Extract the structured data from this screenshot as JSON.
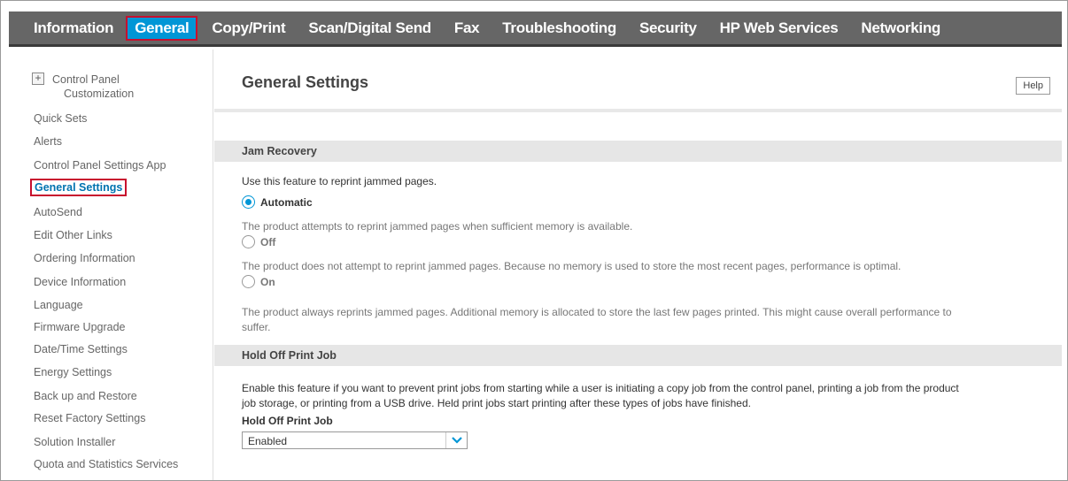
{
  "topnav": {
    "items": [
      "Information",
      "General",
      "Copy/Print",
      "Scan/Digital Send",
      "Fax",
      "Troubleshooting",
      "Security",
      "HP Web Services",
      "Networking"
    ],
    "active": "General"
  },
  "sidebar": {
    "expand_symbol": "+",
    "control_panel_line1": "Control Panel",
    "control_panel_line2": "Customization",
    "items": [
      "Quick Sets",
      "Alerts",
      "Control Panel Settings App",
      "General Settings",
      "AutoSend",
      "Edit Other Links",
      "Ordering Information",
      "Device Information",
      "Language",
      "Firmware Upgrade",
      "Date/Time Settings",
      "Energy Settings",
      "Back up and Restore",
      "Reset Factory Settings",
      "Solution Installer",
      "Quota and Statistics Services"
    ],
    "active": "General Settings"
  },
  "main": {
    "title": "General Settings",
    "help_label": "Help",
    "jam": {
      "title": "Jam Recovery",
      "intro": "Use this feature to reprint jammed pages.",
      "options": [
        {
          "label": "Automatic",
          "selected": true,
          "desc": "The product attempts to reprint jammed pages when sufficient memory is available."
        },
        {
          "label": "Off",
          "selected": false,
          "desc": "The product does not attempt to reprint jammed pages. Because no memory is used to store the most recent pages, performance is optimal."
        },
        {
          "label": "On",
          "selected": false,
          "desc_line1": "The product always reprints jammed pages. Additional memory is allocated to store the last few pages printed. This might cause overall performance to",
          "desc_line2": "suffer."
        }
      ]
    },
    "hold": {
      "title": "Hold Off Print Job",
      "desc_line1": "Enable this feature if you want to prevent print jobs from starting while a user is initiating a copy job from the control panel, printing a job from the product",
      "desc_line2": "job storage, or printing from a USB drive. Held print jobs start printing after these types of jobs have finished.",
      "field_label": "Hold Off Print Job",
      "value": "Enabled"
    }
  },
  "colors": {
    "nav_bg": "#666666",
    "accent": "#0096d6",
    "highlight_border": "#c8102e"
  },
  "icons": {
    "expand": "plus-box-icon",
    "select_arrow": "chevron-down-icon"
  }
}
